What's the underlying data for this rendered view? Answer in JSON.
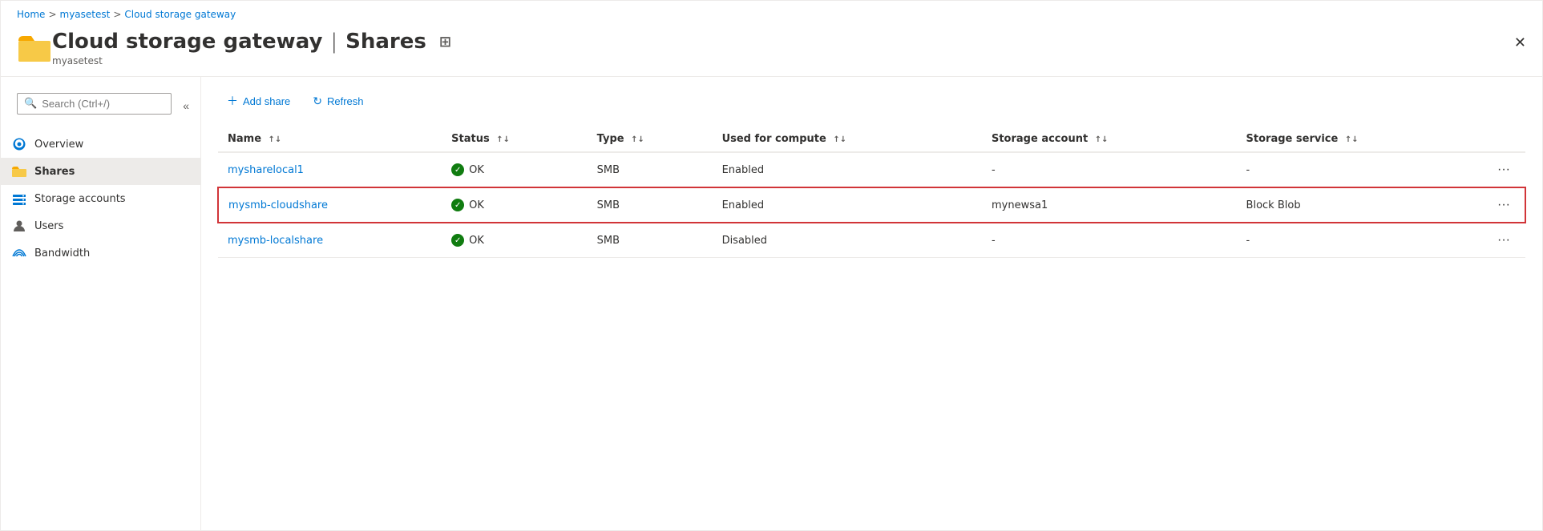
{
  "breadcrumb": {
    "home": "Home",
    "separator1": ">",
    "myasetest": "myasetest",
    "separator2": ">",
    "current": "Cloud storage gateway"
  },
  "header": {
    "title_main": "Cloud storage gateway",
    "separator": "|",
    "title_section": "Shares",
    "subtitle": "myasetest"
  },
  "sidebar": {
    "search_placeholder": "Search (Ctrl+/)",
    "items": [
      {
        "id": "overview",
        "label": "Overview",
        "icon": "cloud"
      },
      {
        "id": "shares",
        "label": "Shares",
        "icon": "folder"
      },
      {
        "id": "storage-accounts",
        "label": "Storage accounts",
        "icon": "storage"
      },
      {
        "id": "users",
        "label": "Users",
        "icon": "user"
      },
      {
        "id": "bandwidth",
        "label": "Bandwidth",
        "icon": "wifi"
      }
    ]
  },
  "toolbar": {
    "add_share_label": "Add share",
    "refresh_label": "Refresh"
  },
  "table": {
    "columns": [
      {
        "id": "name",
        "label": "Name"
      },
      {
        "id": "status",
        "label": "Status"
      },
      {
        "id": "type",
        "label": "Type"
      },
      {
        "id": "used_for_compute",
        "label": "Used for compute"
      },
      {
        "id": "storage_account",
        "label": "Storage account"
      },
      {
        "id": "storage_service",
        "label": "Storage service"
      },
      {
        "id": "actions",
        "label": ""
      }
    ],
    "rows": [
      {
        "name": "mysharelocal1",
        "status": "OK",
        "type": "SMB",
        "used_for_compute": "Enabled",
        "storage_account": "-",
        "storage_service": "-",
        "highlighted": false
      },
      {
        "name": "mysmb-cloudshare",
        "status": "OK",
        "type": "SMB",
        "used_for_compute": "Enabled",
        "storage_account": "mynewsa1",
        "storage_service": "Block Blob",
        "highlighted": true
      },
      {
        "name": "mysmb-localshare",
        "status": "OK",
        "type": "SMB",
        "used_for_compute": "Disabled",
        "storage_account": "-",
        "storage_service": "-",
        "highlighted": false
      }
    ]
  }
}
